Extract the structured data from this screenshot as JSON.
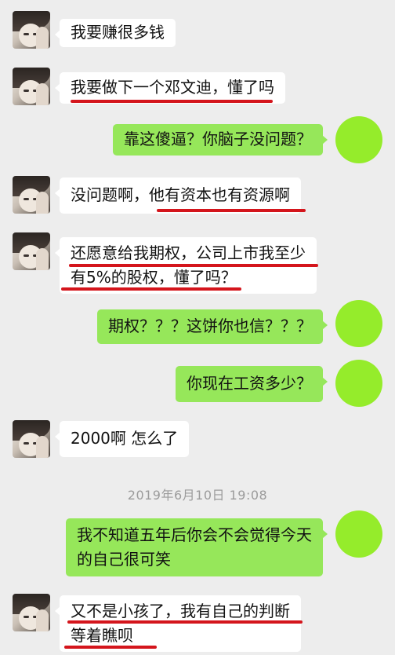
{
  "messages": [
    {
      "text": "我要赚很多钱"
    },
    {
      "text": "我要做下一个邓文迪，懂了吗"
    },
    {
      "text": "靠这傻逼？你脑子没问题？"
    },
    {
      "text": "没问题啊，他有资本也有资源啊"
    },
    {
      "line1": "还愿意给我期权，公司上市我至少",
      "line2": "有5%的股权，懂了吗？"
    },
    {
      "text": "期权？？？这饼你也信？？？"
    },
    {
      "text": "你现在工资多少？"
    },
    {
      "text": "2000啊 怎么了"
    },
    {
      "line1": "我不知道五年后你会不会觉得今天",
      "line2": "的自己很可笑"
    },
    {
      "line1": "又不是小孩了，我有自己的判断",
      "line2": "等着瞧呗"
    }
  ],
  "timestamp": "2019年6月10日 19:08",
  "colors": {
    "background": "#ededed",
    "incoming_bubble": "#ffffff",
    "outgoing_bubble": "#96e75a",
    "self_avatar": "#95ec2b",
    "underline": "#d4151c"
  },
  "icons": {
    "contact_avatar": "contact-avatar",
    "self_avatar": "self-avatar"
  }
}
